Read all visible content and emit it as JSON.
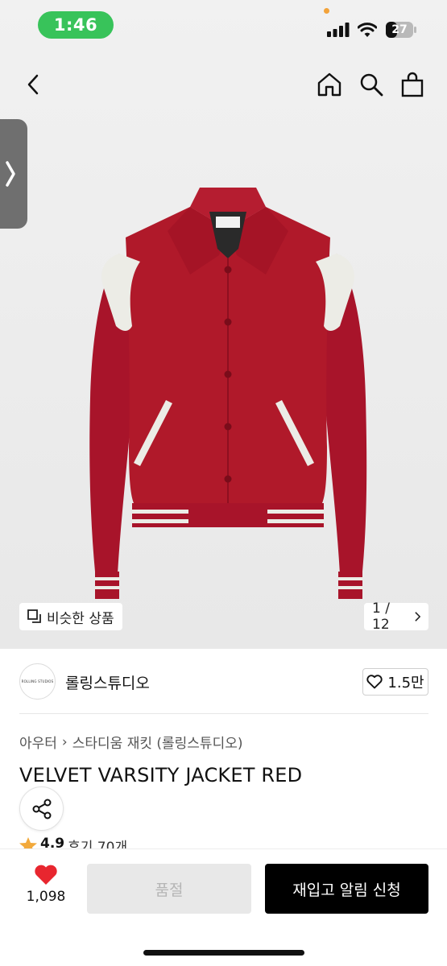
{
  "status_bar": {
    "time": "1:46",
    "battery": "27",
    "accent_color": "#38c35a"
  },
  "nav": {
    "icons": [
      "back-icon",
      "home-icon",
      "search-icon",
      "shopping-bag-icon"
    ]
  },
  "gallery": {
    "similar_label": "비슷한 상품",
    "counter": "1 / 12",
    "side_tab_icon": "chevron-right-icon"
  },
  "seller": {
    "logo_text": "ROLLING STUDIOS",
    "name": "롤링스튜디오",
    "likes": "1.5만"
  },
  "product": {
    "breadcrumb": [
      "아우터",
      "스타디움 재킷 (롤링스튜디오)"
    ],
    "title": "VELVET VARSITY JACKET RED",
    "rating_score": "4.9",
    "review_label": "후기 70개",
    "colors": {
      "jacket": "#b0192a",
      "trim": "#ecece6"
    }
  },
  "bottom": {
    "favorite_count": "1,098",
    "soldout_label": "품절",
    "restock_label": "재입고 알림 신청",
    "heart_color": "#e8262f"
  }
}
